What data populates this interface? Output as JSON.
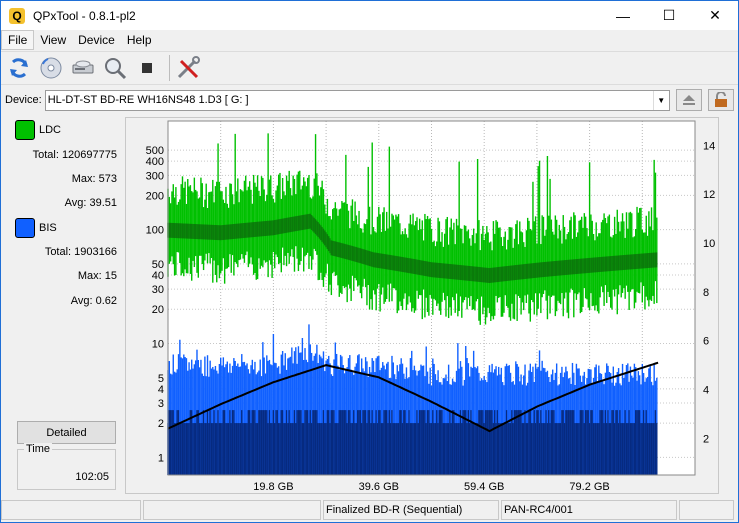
{
  "window": {
    "title": "QPxTool - 0.8.1-pl2",
    "app_icon_letter": "Q",
    "controls": {
      "minimize": "—",
      "maximize": "☐",
      "close": "✕"
    }
  },
  "menu": [
    "File",
    "View",
    "Device",
    "Help"
  ],
  "toolbar": {
    "icons": [
      "refresh-icon",
      "disc-scan-icon",
      "drive-icon",
      "magnifier-icon",
      "stop-icon",
      "tools-icon"
    ]
  },
  "device": {
    "label": "Device:",
    "selected": "HL-DT-ST BD-RE  WH16NS48  1.D3 [ G: ]"
  },
  "stats": {
    "ldc": {
      "label": "LDC",
      "color": "#00c000",
      "total_label": "Total:",
      "total": "120697775",
      "max_label": "Max:",
      "max": "573",
      "avg_label": "Avg:",
      "avg": "39.51"
    },
    "bis": {
      "label": "BIS",
      "color": "#1060ff",
      "total_label": "Total:",
      "total": "1903166",
      "max_label": "Max:",
      "max": "15",
      "avg_label": "Avg:",
      "avg": "0.62"
    }
  },
  "detailed_button": "Detailed",
  "time": {
    "label": "Time",
    "value": "102:05"
  },
  "chart_data": {
    "type": "area",
    "x_unit": "GB",
    "x_ticks": [
      "19.8 GB",
      "39.6 GB",
      "59.4 GB",
      "79.2 GB"
    ],
    "left_axis_ticks": [
      "500",
      "400",
      "300",
      "200",
      "100",
      "50",
      "40",
      "30",
      "20",
      "10",
      "5",
      "4",
      "3",
      "2",
      "1"
    ],
    "right_axis_ticks": [
      "14",
      "12",
      "10",
      "8",
      "6",
      "4",
      "2"
    ],
    "left_axis_scale": "log",
    "grid": true,
    "series": [
      {
        "name": "LDC",
        "color": "#00c000",
        "x": [
          0,
          10,
          20,
          27,
          31,
          39,
          50,
          61,
          71,
          82,
          93
        ],
        "values": [
          100,
          95,
          105,
          120,
          70,
          55,
          45,
          40,
          45,
          50,
          55
        ]
      },
      {
        "name": "BIS",
        "color": "#1060ff",
        "x": [
          0,
          10,
          20,
          27,
          31,
          39,
          50,
          61,
          71,
          82,
          93
        ],
        "values": [
          6,
          6,
          6,
          8,
          6,
          6,
          5,
          5,
          5,
          5,
          5
        ]
      },
      {
        "color": "#000000",
        "x": [
          0,
          10,
          20,
          30,
          40,
          50,
          61,
          70,
          80,
          93
        ],
        "values": [
          2.4,
          3.4,
          4.3,
          5.0,
          4.5,
          3.5,
          2.3,
          3.3,
          4.2,
          5.1
        ]
      }
    ]
  },
  "status": [
    "",
    "",
    "Finalized BD-R (Sequential)",
    "PAN-RC4/001",
    ""
  ]
}
